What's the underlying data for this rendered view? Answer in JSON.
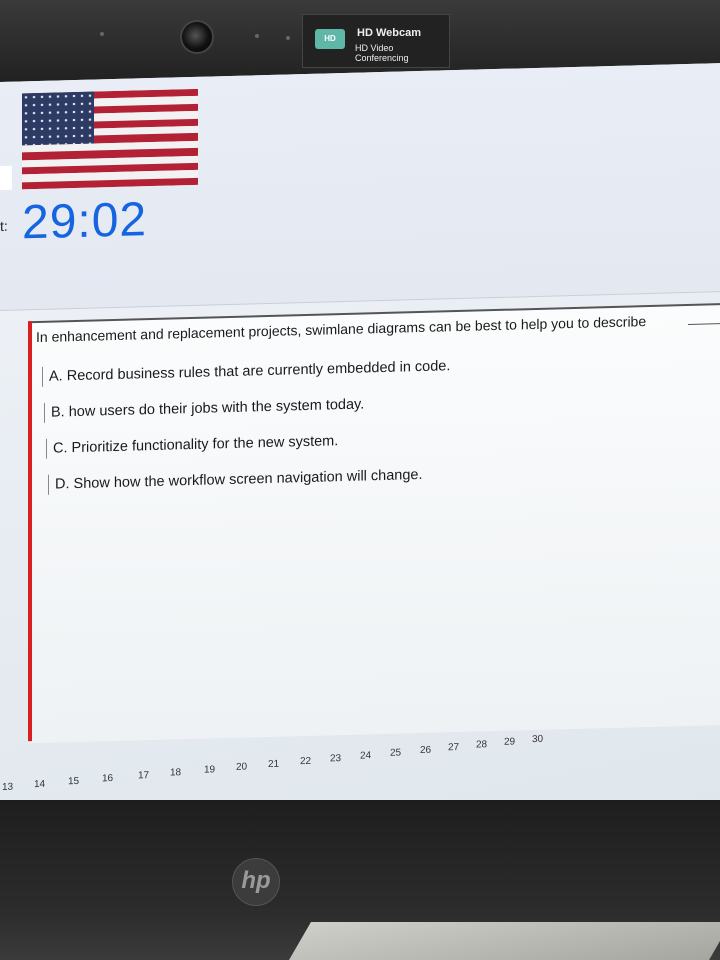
{
  "webcam": {
    "title": "HD Webcam",
    "subtitle": "HD Video Conferencing",
    "icon": "webcam-icon"
  },
  "header": {
    "flag": "us-flag-icon",
    "timer_prefix": "t:",
    "timer": "29:02"
  },
  "question": {
    "text": "In enhancement and replacement projects, swimlane diagrams can be best to help you to describe",
    "options": [
      {
        "label": "A. Record business rules that are currently embedded in code."
      },
      {
        "label": "B. how users do their jobs with the system today."
      },
      {
        "label": "C. Prioritize functionality for the new system."
      },
      {
        "label": "D. Show how the workflow screen navigation will change."
      }
    ]
  },
  "pagination": {
    "pages": [
      "13",
      "14",
      "15",
      "16",
      "17",
      "18",
      "19",
      "20",
      "21",
      "22",
      "23",
      "24",
      "25",
      "26",
      "27",
      "28",
      "29",
      "30"
    ]
  },
  "laptop": {
    "brand_logo": "hp"
  },
  "colors": {
    "timer": "#1565e0",
    "accent_bar": "#d92020"
  }
}
